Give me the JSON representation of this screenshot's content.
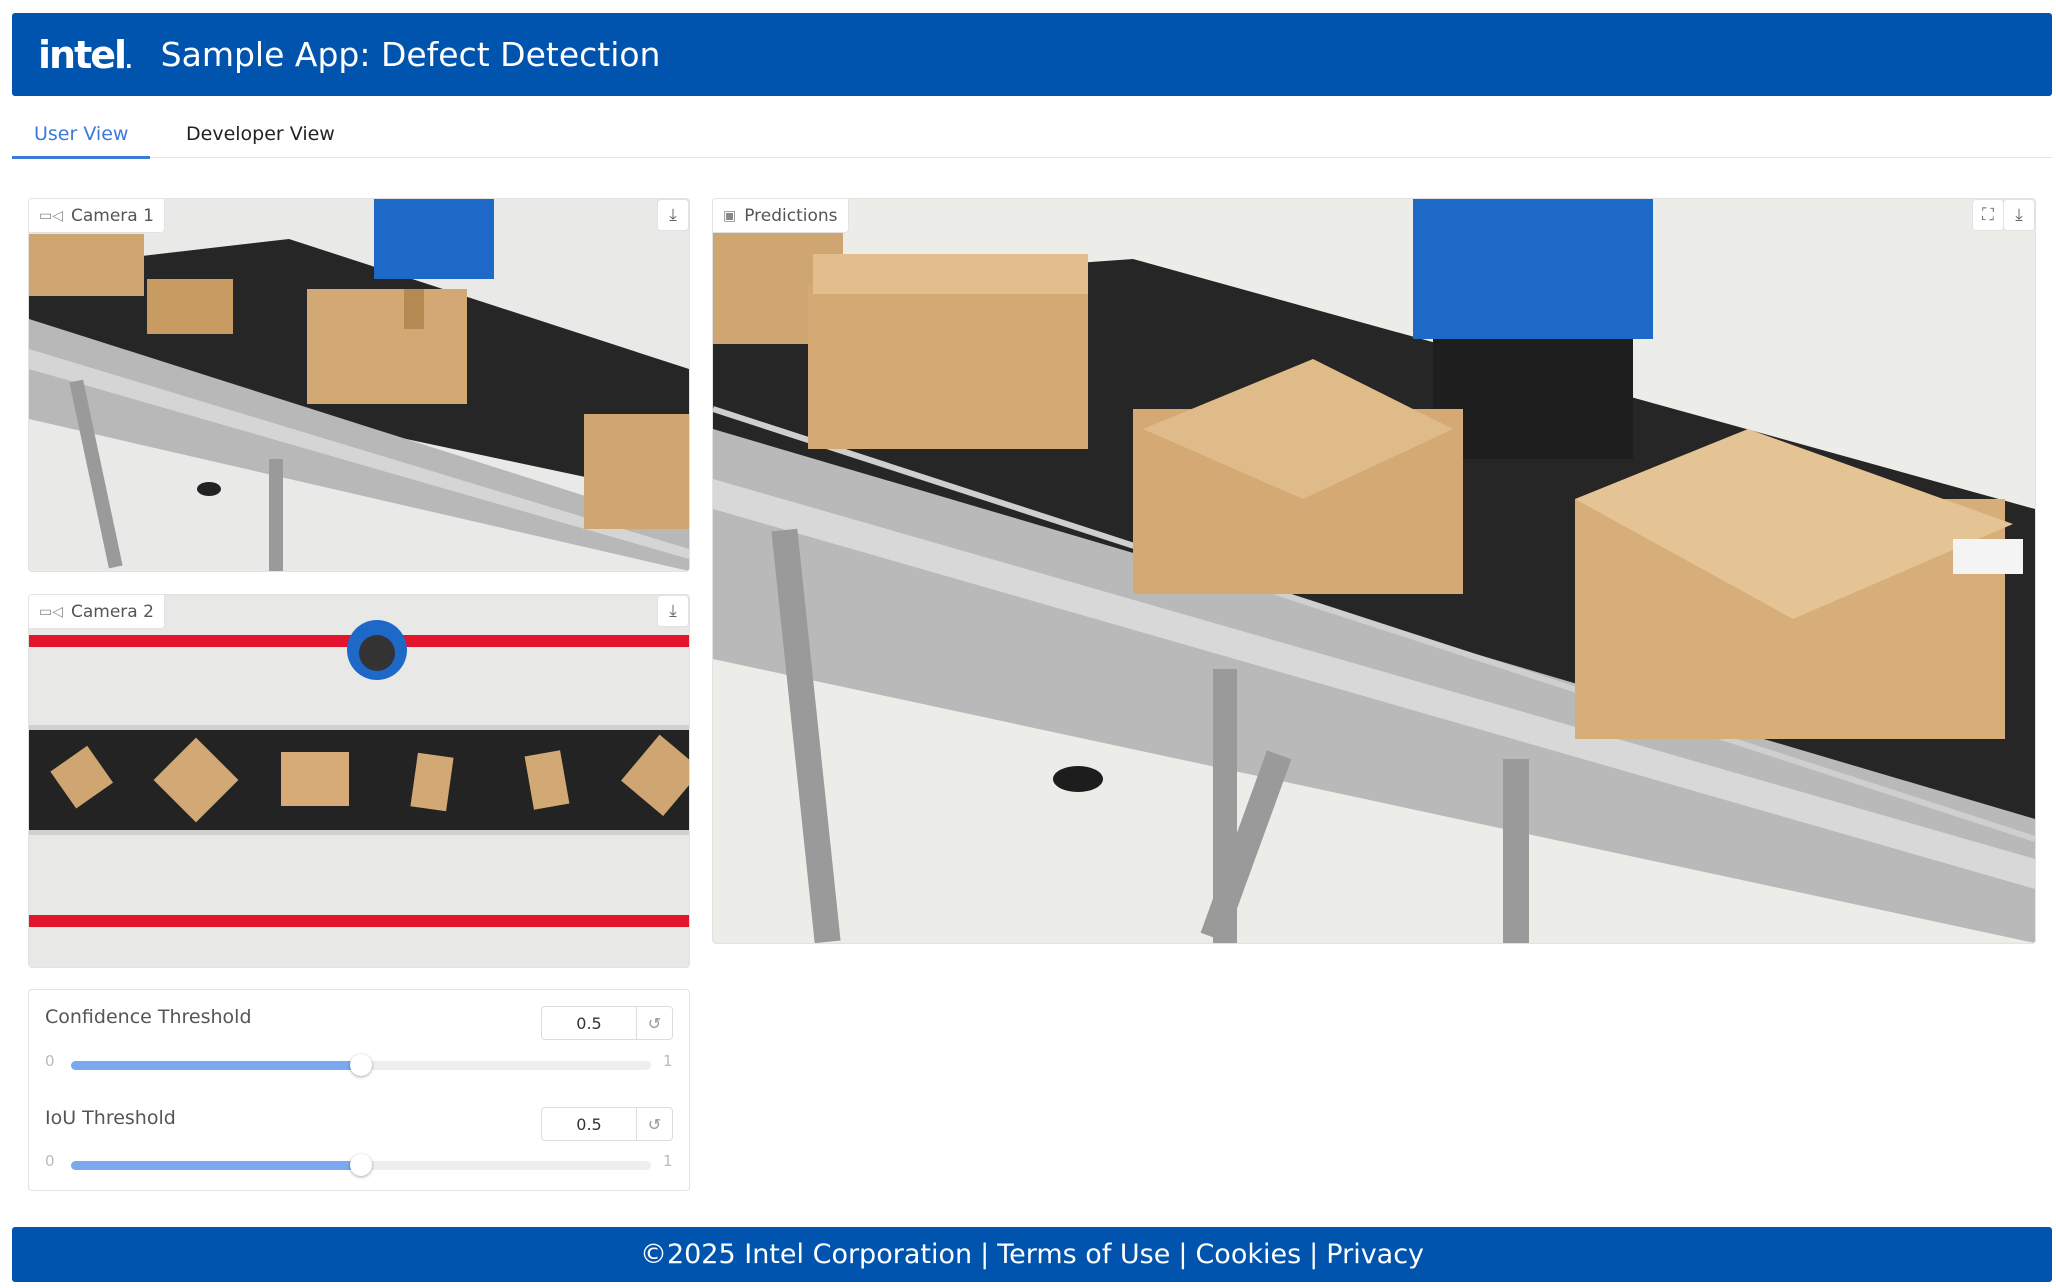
{
  "header": {
    "logo": "intel",
    "title": "Sample App: Defect Detection"
  },
  "tabs": [
    {
      "label": "User View",
      "active": true
    },
    {
      "label": "Developer View",
      "active": false
    }
  ],
  "panels": {
    "camera1": {
      "label": "Camera 1"
    },
    "camera2": {
      "label": "Camera 2"
    },
    "predictions": {
      "label": "Predictions"
    }
  },
  "controls": {
    "confidence": {
      "label": "Confidence Threshold",
      "value": "0.5",
      "min": "0",
      "max": "1",
      "level": 0.5
    },
    "iou": {
      "label": "IoU Threshold",
      "value": "0.5",
      "min": "0",
      "max": "1",
      "level": 0.5
    }
  },
  "footer": {
    "copyright": "©2025 Intel Corporation",
    "terms": "Terms of Use",
    "cookies": "Cookies",
    "privacy": "Privacy",
    "separator": "|"
  },
  "icons": {
    "video": "video-camera-icon",
    "image": "image-icon",
    "download": "download-icon",
    "fullscreen": "fullscreen-icon",
    "reset": "reset-icon"
  },
  "colors": {
    "brand": "#0054ae",
    "accent": "#3b7ad9",
    "slider_fill": "#7aa9ef",
    "stripe": "#e3152c"
  }
}
